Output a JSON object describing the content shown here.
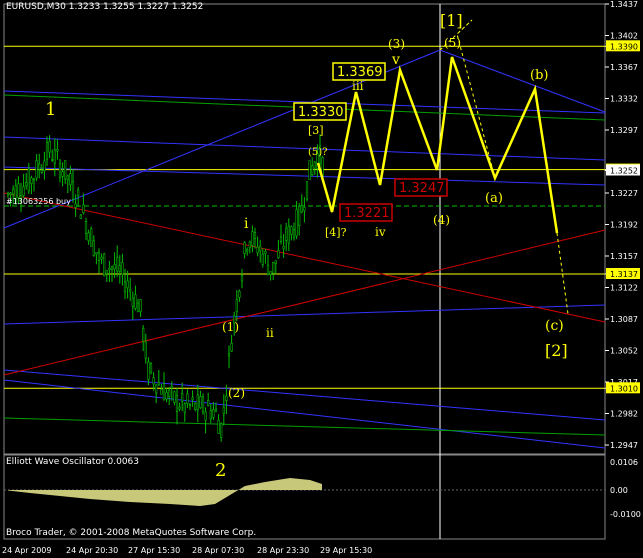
{
  "header": {
    "symbol": "EURUSD,M30",
    "open": "1.3233",
    "high": "1.3255",
    "low": "1.3227",
    "close": "1.3252"
  },
  "oscillator": {
    "label": "Elliott Wave Oscillator 0.0063",
    "ticks": [
      "0.0106",
      "0.00",
      "-0.0100"
    ]
  },
  "copyright": "Broco Trader, © 2001-2008 MetaQuotes Software Corp.",
  "order_label": "#13063256 buy",
  "colors": {
    "price": "#00c000",
    "wave": "#ffff00",
    "grid": "#ffffff",
    "channel": "#3333ff",
    "trend": "#cc0000",
    "osc": "#c8c87a"
  },
  "chart_data": {
    "type": "candlestick",
    "y_ticks": [
      "1.3437",
      "1.3402",
      "1.3390",
      "1.3367",
      "1.3332",
      "1.3297",
      "1.3253",
      "1.3252",
      "1.3227",
      "1.3192",
      "1.3157",
      "1.3137",
      "1.3122",
      "1.3087",
      "1.3052",
      "1.3017",
      "1.3010",
      "1.2982",
      "1.2947"
    ],
    "x_ticks": [
      "24 Apr 2009",
      "24 Apr 20:30",
      "27 Apr 15:30",
      "28 Apr 07:30",
      "28 Apr 23:30",
      "29 Apr 15:30"
    ],
    "price_levels": {
      "wave1": 1.3297,
      "wave2": 1.2957,
      "hline_1": 1.339,
      "hline_2": 1.3253,
      "hline_3": 1.3137,
      "hline_4": 1.301
    },
    "projection_boxes": [
      "1.3369",
      "1.3330",
      "1.3247",
      "1.3221"
    ],
    "wave_labels": [
      "1",
      "2",
      "i",
      "ii",
      "iii",
      "iv",
      "v",
      "(1)",
      "(2)",
      "(3)",
      "(4)",
      "(5)",
      "(a)",
      "(b)",
      "(c)",
      "[1]",
      "[2]",
      "[3]",
      "[4]?",
      "(5)?"
    ]
  }
}
